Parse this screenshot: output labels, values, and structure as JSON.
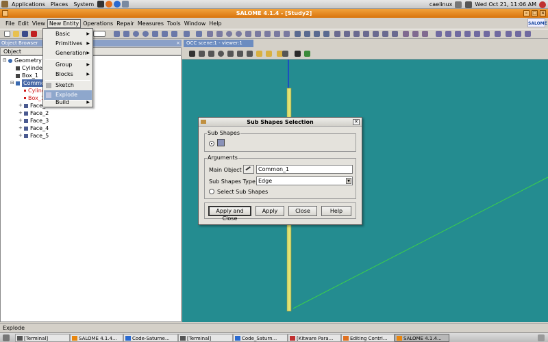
{
  "top_panel": {
    "applications": "Applications",
    "places": "Places",
    "system": "System",
    "user": "caelinux",
    "clock": "Wed Oct 21, 11:06 AM"
  },
  "window": {
    "title": "SALOME 4.1.4 - [Study2]",
    "logo": "SALOME"
  },
  "menubar": {
    "items": [
      "File",
      "Edit",
      "View",
      "New Entity",
      "Operations",
      "Repair",
      "Measures",
      "Tools",
      "Window",
      "Help"
    ],
    "open_menu": "New Entity"
  },
  "new_entity_menu": {
    "items": [
      {
        "label": "Basic",
        "submenu": true
      },
      {
        "label": "Primitives",
        "submenu": true
      },
      {
        "label": "Generation",
        "submenu": true
      },
      {
        "label": "Group",
        "submenu": true
      },
      {
        "label": "Blocks",
        "submenu": true
      },
      {
        "label": "Sketch",
        "submenu": false
      },
      {
        "label": "Explode",
        "submenu": false,
        "highlighted": true
      },
      {
        "label": "Build",
        "submenu": true
      }
    ]
  },
  "object_browser": {
    "title": "Object Browser",
    "column": "Object",
    "tree": [
      {
        "label": "Geometry",
        "level": 0
      },
      {
        "label": "Cylinder",
        "level": 1
      },
      {
        "label": "Box_1",
        "level": 1
      },
      {
        "label": "Common",
        "level": 1,
        "selected": true
      },
      {
        "label": "Cylinder",
        "level": 2,
        "color": "red"
      },
      {
        "label": "Box_1",
        "level": 2,
        "color": "red"
      },
      {
        "label": "Face_1",
        "level": 2
      },
      {
        "label": "Face_2",
        "level": 2
      },
      {
        "label": "Face_3",
        "level": 2
      },
      {
        "label": "Face_4",
        "level": 2
      },
      {
        "label": "Face_5",
        "level": 2
      }
    ]
  },
  "viewer": {
    "tab": "OCC scene:1 - viewer:1"
  },
  "dialog": {
    "title": "Sub Shapes Selection",
    "close": "✕",
    "sub_shapes_group": "Sub Shapes",
    "arguments_group": "Arguments",
    "main_object_label": "Main Object",
    "main_object_value": "Common_1",
    "sub_shapes_type_label": "Sub Shapes Type :",
    "sub_shapes_type_value": "Edge",
    "select_sub_shapes_label": "Select Sub Shapes",
    "buttons": {
      "apply_and_close": "Apply and Close",
      "apply": "Apply",
      "close": "Close",
      "help": "Help"
    }
  },
  "status_bar": {
    "text": "Explode"
  },
  "taskbar": {
    "tasks": [
      {
        "label": "[Terminal]"
      },
      {
        "label": "SALOME 4.1.4..."
      },
      {
        "label": "Code-Saturne..."
      },
      {
        "label": "[Terminal]"
      },
      {
        "label": "Code_Saturn..."
      },
      {
        "label": "[Kitware Para..."
      },
      {
        "label": "Editing Contri..."
      },
      {
        "label": "SALOME 4.1.4...",
        "active": true
      }
    ]
  },
  "colors": {
    "viewer_bg": "#248c90",
    "title_bar": "#e8860f",
    "selection": "#4a6aa8",
    "menu_highlight": "#8ea7cc",
    "geometry_yellow": "#e6e878",
    "axis_green": "#3cd04a"
  }
}
